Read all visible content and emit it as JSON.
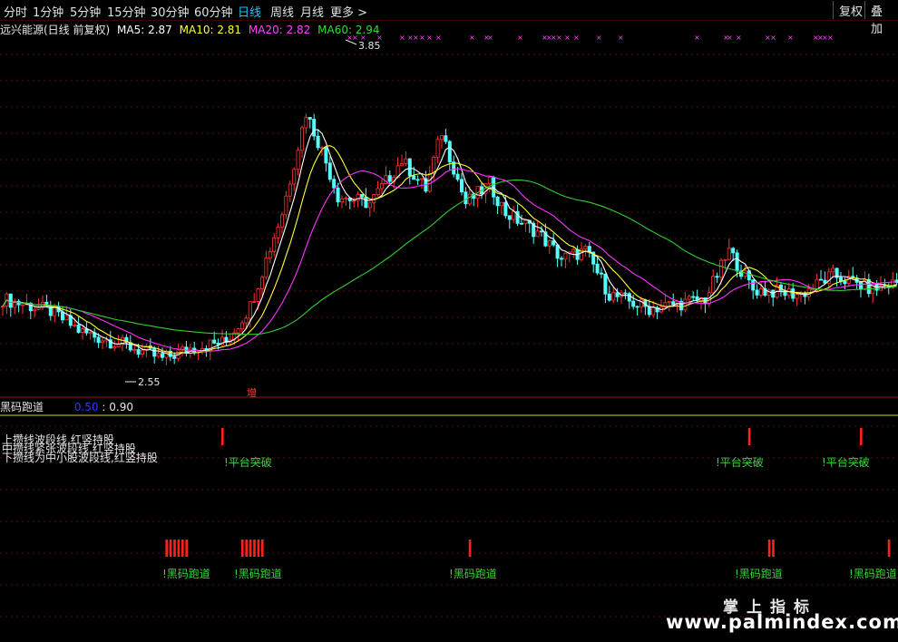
{
  "toolbar": {
    "tabs": [
      "分时",
      "1分钟",
      "5分钟",
      "15分钟",
      "30分钟",
      "60分钟",
      "日线",
      "周线",
      "月线",
      "更多 >"
    ],
    "active_tab": "日线",
    "right_buttons": [
      "复权",
      "叠加"
    ]
  },
  "legend": {
    "title": "远兴能源(日线 前复权)",
    "ma5_label": "MA5: 2.87",
    "ma10_label": "MA10: 2.81",
    "ma20_label": "MA20: 2.82",
    "ma60_label": "MA60: 2.94",
    "colors": {
      "ma5": "#ffffff",
      "ma10": "#ffff33",
      "ma20": "#ff33ff",
      "ma60": "#33cc33"
    }
  },
  "annotations": {
    "high_label": "3.85",
    "low_label": "2.55",
    "zeng": "增"
  },
  "sub_panel": {
    "title": "黑码跑道",
    "val1": "0.50",
    "val2": ": 0.90",
    "notes": [
      "上攒线波段线,红竖持股",
      "中攒线紧张波段线,红竖持股",
      "下攒线为中小股波段线,红竖持股"
    ],
    "platform_label": "!平台突破",
    "runway_label": "!黑码跑道"
  },
  "watermark": {
    "line1": "掌上指标",
    "line2": "www.palmindex.com"
  },
  "chart_data": {
    "type": "candlestick",
    "symbol": "远兴能源",
    "period": "日线",
    "adjust": "前复权",
    "ma_latest": {
      "MA5": 2.87,
      "MA10": 2.81,
      "MA20": 2.82,
      "MA60": 2.94
    },
    "price_range_visible": [
      2.55,
      3.85
    ],
    "marked_high": 3.85,
    "marked_low": 2.55,
    "close_path_anchors": [
      [
        0,
        2.82
      ],
      [
        12,
        2.77
      ],
      [
        20,
        2.68
      ],
      [
        32,
        2.62
      ],
      [
        40,
        2.57
      ],
      [
        48,
        2.62
      ],
      [
        56,
        2.64
      ],
      [
        62,
        2.79
      ],
      [
        70,
        3.18
      ],
      [
        76,
        3.6
      ],
      [
        80,
        3.44
      ],
      [
        84,
        3.25
      ],
      [
        92,
        3.22
      ],
      [
        100,
        3.4
      ],
      [
        106,
        3.28
      ],
      [
        110,
        3.52
      ],
      [
        116,
        3.22
      ],
      [
        122,
        3.3
      ],
      [
        126,
        3.18
      ],
      [
        134,
        3.1
      ],
      [
        140,
        2.99
      ],
      [
        146,
        3.02
      ],
      [
        152,
        2.84
      ],
      [
        162,
        2.78
      ],
      [
        176,
        2.82
      ],
      [
        182,
        3.02
      ],
      [
        188,
        2.86
      ],
      [
        200,
        2.84
      ],
      [
        208,
        2.92
      ],
      [
        218,
        2.86
      ],
      [
        224,
        2.89
      ]
    ],
    "platform_breakout_bars": [
      55,
      187,
      215
    ],
    "runway_bars": [
      41,
      42,
      43,
      44,
      45,
      46,
      60,
      61,
      62,
      63,
      64,
      65,
      117,
      192,
      193,
      222
    ]
  }
}
